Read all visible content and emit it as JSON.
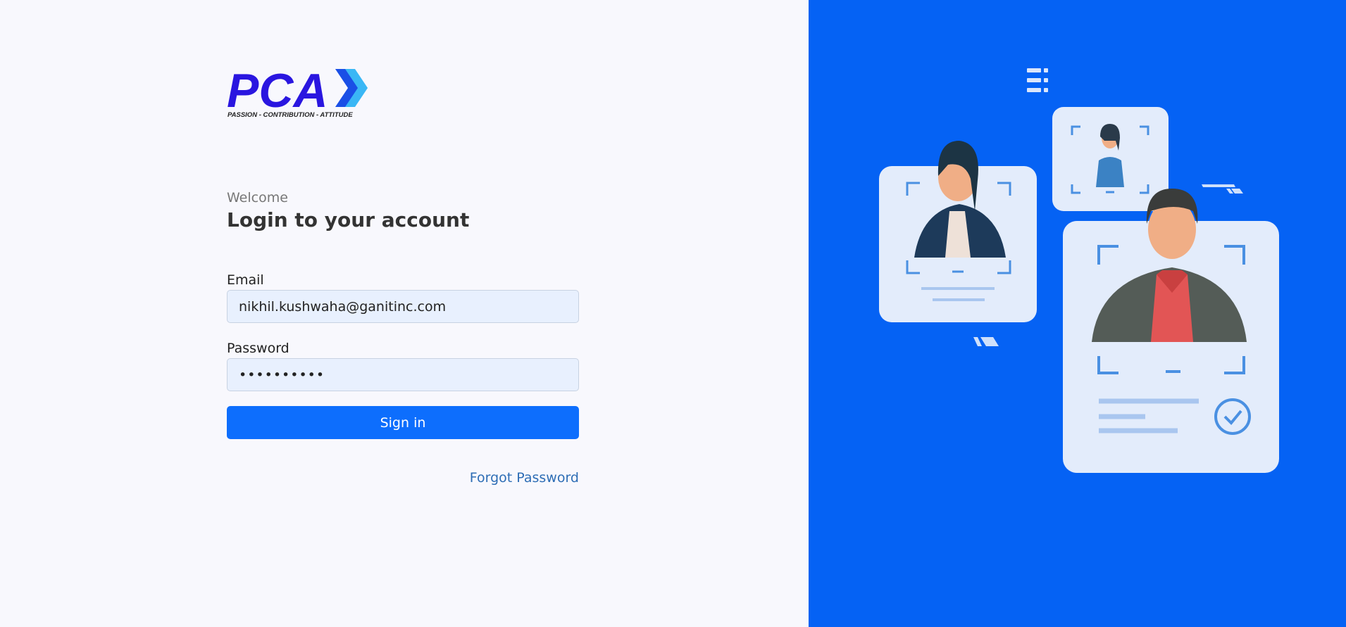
{
  "brand": {
    "logo_text": "PCA",
    "tagline": "PASSION - CONTRIBUTION - ATTITUDE",
    "colors": {
      "logo_primary": "#2a16e0",
      "logo_chevron_dark": "#1a4fe6",
      "logo_chevron_light": "#3ab7f5"
    }
  },
  "login": {
    "welcome": "Welcome",
    "heading": "Login to your account",
    "email_label": "Email",
    "email_value": "nikhil.kushwaha@ganitinc.com",
    "password_label": "Password",
    "password_value": "••••••••••",
    "signin_label": "Sign in",
    "forgot_label": "Forgot Password"
  },
  "illustration": {
    "icon": "face-recognition-profiles-illustration",
    "background_color": "#0562f4"
  }
}
